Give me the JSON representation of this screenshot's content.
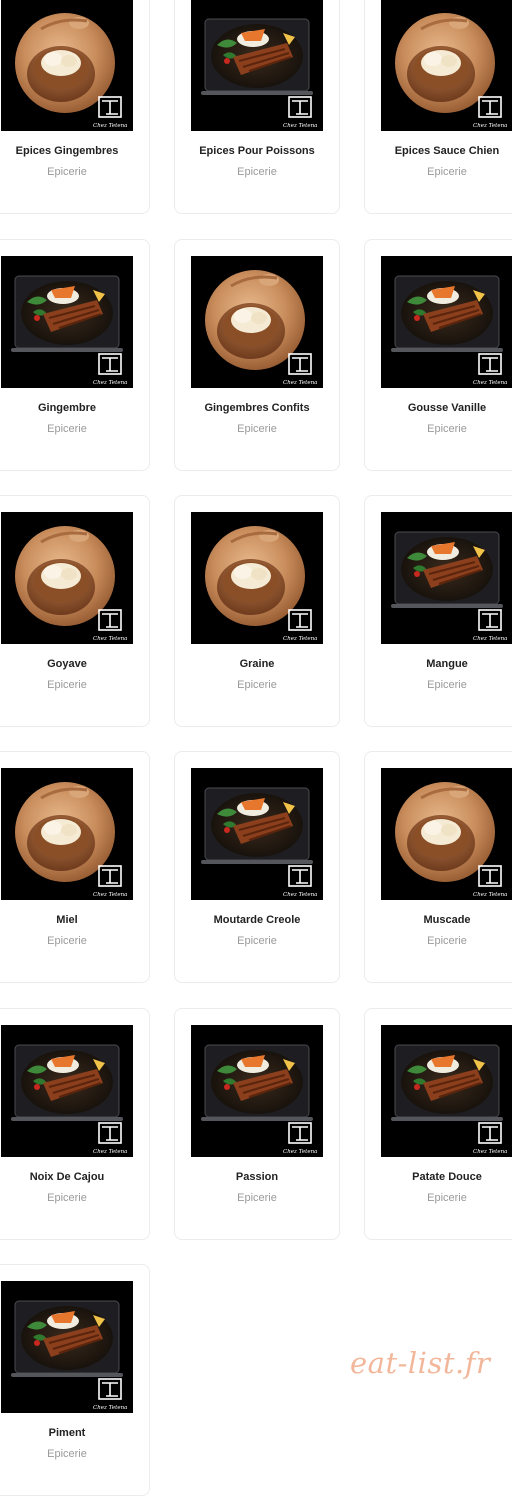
{
  "products": [
    {
      "name": "Epices Gingembres",
      "category": "Epicerie",
      "image": "bowl-image"
    },
    {
      "name": "Epices Pour Poissons",
      "category": "Epicerie",
      "image": "plate-image"
    },
    {
      "name": "Epices Sauce Chien",
      "category": "Epicerie",
      "image": "bowl-image"
    },
    {
      "name": "Gingembre",
      "category": "Epicerie",
      "image": "plate-image"
    },
    {
      "name": "Gingembres Confits",
      "category": "Epicerie",
      "image": "bowl-image"
    },
    {
      "name": "Gousse Vanille",
      "category": "Epicerie",
      "image": "plate-image"
    },
    {
      "name": "Goyave",
      "category": "Epicerie",
      "image": "bowl-image"
    },
    {
      "name": "Graine",
      "category": "Epicerie",
      "image": "bowl-image"
    },
    {
      "name": "Mangue",
      "category": "Epicerie",
      "image": "plate-image"
    },
    {
      "name": "Miel",
      "category": "Epicerie",
      "image": "bowl-image"
    },
    {
      "name": "Moutarde Creole",
      "category": "Epicerie",
      "image": "plate-image"
    },
    {
      "name": "Muscade",
      "category": "Epicerie",
      "image": "bowl-image"
    },
    {
      "name": "Noix De Cajou",
      "category": "Epicerie",
      "image": "plate-image"
    },
    {
      "name": "Passion",
      "category": "Epicerie",
      "image": "plate-image"
    },
    {
      "name": "Patate Douce",
      "category": "Epicerie",
      "image": "plate-image"
    },
    {
      "name": "Piment",
      "category": "Epicerie",
      "image": "plate-image"
    }
  ],
  "thumbnail_logo_text": "Chez Tetena",
  "watermark": "eat-list.fr",
  "colors": {
    "card_border": "#ececec",
    "category_text": "#9a9a9a",
    "watermark": "#f2b79a"
  }
}
